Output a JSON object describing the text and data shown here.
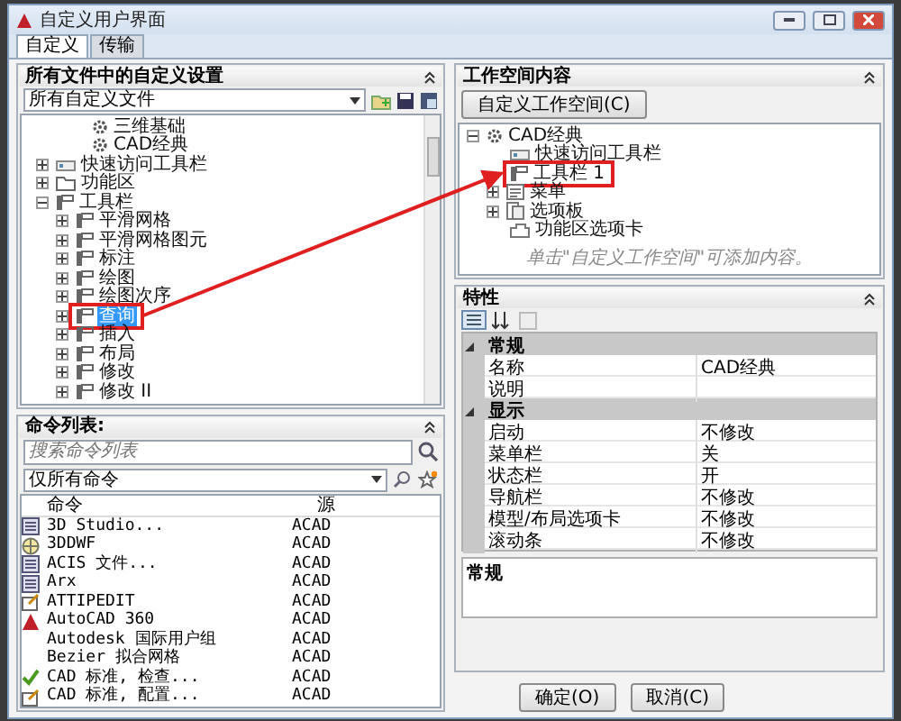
{
  "window": {
    "title": "自定义用户界面"
  },
  "tabs": [
    {
      "label": "自定义",
      "selected": true
    },
    {
      "label": "传输",
      "selected": false
    }
  ],
  "customizations": {
    "header": "所有文件中的自定义设置",
    "file_filter": "所有自定义文件",
    "tree": [
      {
        "label": "三维基础",
        "kind": "workspace",
        "marked": false,
        "selected": false
      },
      {
        "label": "CAD经典",
        "kind": "workspace",
        "marked": false,
        "selected": false
      },
      {
        "label": "快速访问工具栏",
        "kind": "quickbar",
        "expanded": false,
        "marked": false,
        "selected": false
      },
      {
        "label": "功能区",
        "kind": "folder",
        "expanded": false,
        "marked": false,
        "selected": false
      },
      {
        "label": "工具栏",
        "kind": "toolbar",
        "expanded": true,
        "marked": false,
        "selected": false,
        "children": [
          {
            "label": "平滑网格",
            "kind": "toolbar",
            "expanded": false,
            "marked": false,
            "selected": false
          },
          {
            "label": "平滑网格图元",
            "kind": "toolbar",
            "expanded": false,
            "marked": false,
            "selected": false
          },
          {
            "label": "标注",
            "kind": "toolbar",
            "expanded": false,
            "marked": false,
            "selected": false
          },
          {
            "label": "绘图",
            "kind": "toolbar",
            "expanded": false,
            "marked": false,
            "selected": false
          },
          {
            "label": "绘图次序",
            "kind": "toolbar",
            "expanded": false,
            "marked": false,
            "selected": false
          },
          {
            "label": "查询",
            "kind": "toolbar",
            "expanded": false,
            "marked": true,
            "selected": true
          },
          {
            "label": "插入",
            "kind": "toolbar",
            "expanded": false,
            "marked": false,
            "selected": false
          },
          {
            "label": "布局",
            "kind": "toolbar",
            "expanded": false,
            "marked": false,
            "selected": false
          },
          {
            "label": "修改",
            "kind": "toolbar",
            "expanded": false,
            "marked": false,
            "selected": false
          },
          {
            "label": "修改 II",
            "kind": "toolbar",
            "expanded": false,
            "marked": false,
            "selected": false
          }
        ]
      }
    ]
  },
  "command_list": {
    "header": "命令列表:",
    "search": {
      "placeholder": "搜索命令列表"
    },
    "filter": "仅所有命令",
    "columns": [
      "命令",
      "源"
    ],
    "rows": [
      {
        "command": "3D Studio...",
        "source": "ACAD",
        "kind": "file"
      },
      {
        "command": "3DDWF",
        "source": "ACAD",
        "kind": "globe"
      },
      {
        "command": "ACIS 文件...",
        "source": "ACAD",
        "kind": "file"
      },
      {
        "command": "Arx",
        "source": "ACAD",
        "kind": "file"
      },
      {
        "command": "ATTIPEDIT",
        "source": "ACAD",
        "kind": "edit"
      },
      {
        "command": "AutoCAD 360",
        "source": "ACAD",
        "kind": "logo"
      },
      {
        "command": "Autodesk 国际用户组",
        "source": "ACAD",
        "kind": "none"
      },
      {
        "command": "Bezier 拟合网格",
        "source": "ACAD",
        "kind": "none"
      },
      {
        "command": "CAD 标准, 检查...",
        "source": "ACAD",
        "kind": "check"
      },
      {
        "command": "CAD 标准, 配置...",
        "source": "ACAD",
        "kind": "edit"
      }
    ]
  },
  "workspace": {
    "header": "工作空间内容",
    "button": "自定义工作空间(C)",
    "tree": [
      {
        "label": "CAD经典",
        "kind": "workspace",
        "expanded": true,
        "marked": false,
        "children": [
          {
            "label": "快速访问工具栏",
            "kind": "quickbar",
            "marked": false
          },
          {
            "label": "工具栏 1",
            "kind": "toolbar",
            "marked": true
          },
          {
            "label": "菜单",
            "kind": "menu",
            "expanded": false,
            "marked": false
          },
          {
            "label": "选项板",
            "kind": "palette",
            "expanded": false,
            "marked": false
          },
          {
            "label": "功能区选项卡",
            "kind": "ribbon",
            "marked": false
          }
        ]
      }
    ],
    "hint": "单击\"自定义工作空间\"可添加内容。"
  },
  "properties": {
    "header": "特性",
    "groups": [
      {
        "name": "常规",
        "expanded": true,
        "rows": [
          {
            "name": "名称",
            "value": "CAD经典"
          },
          {
            "name": "说明",
            "value": ""
          }
        ]
      },
      {
        "name": "显示",
        "expanded": true,
        "rows": [
          {
            "name": "启动",
            "value": "不修改"
          },
          {
            "name": "菜单栏",
            "value": "关"
          },
          {
            "name": "状态栏",
            "value": "开"
          },
          {
            "name": "导航栏",
            "value": "不修改"
          },
          {
            "name": "模型/布局选项卡",
            "value": "不修改"
          },
          {
            "name": "滚动条",
            "value": "不修改"
          }
        ]
      }
    ],
    "description_title": "常规"
  },
  "buttons": [
    "确定(O)",
    "取消(C)"
  ]
}
